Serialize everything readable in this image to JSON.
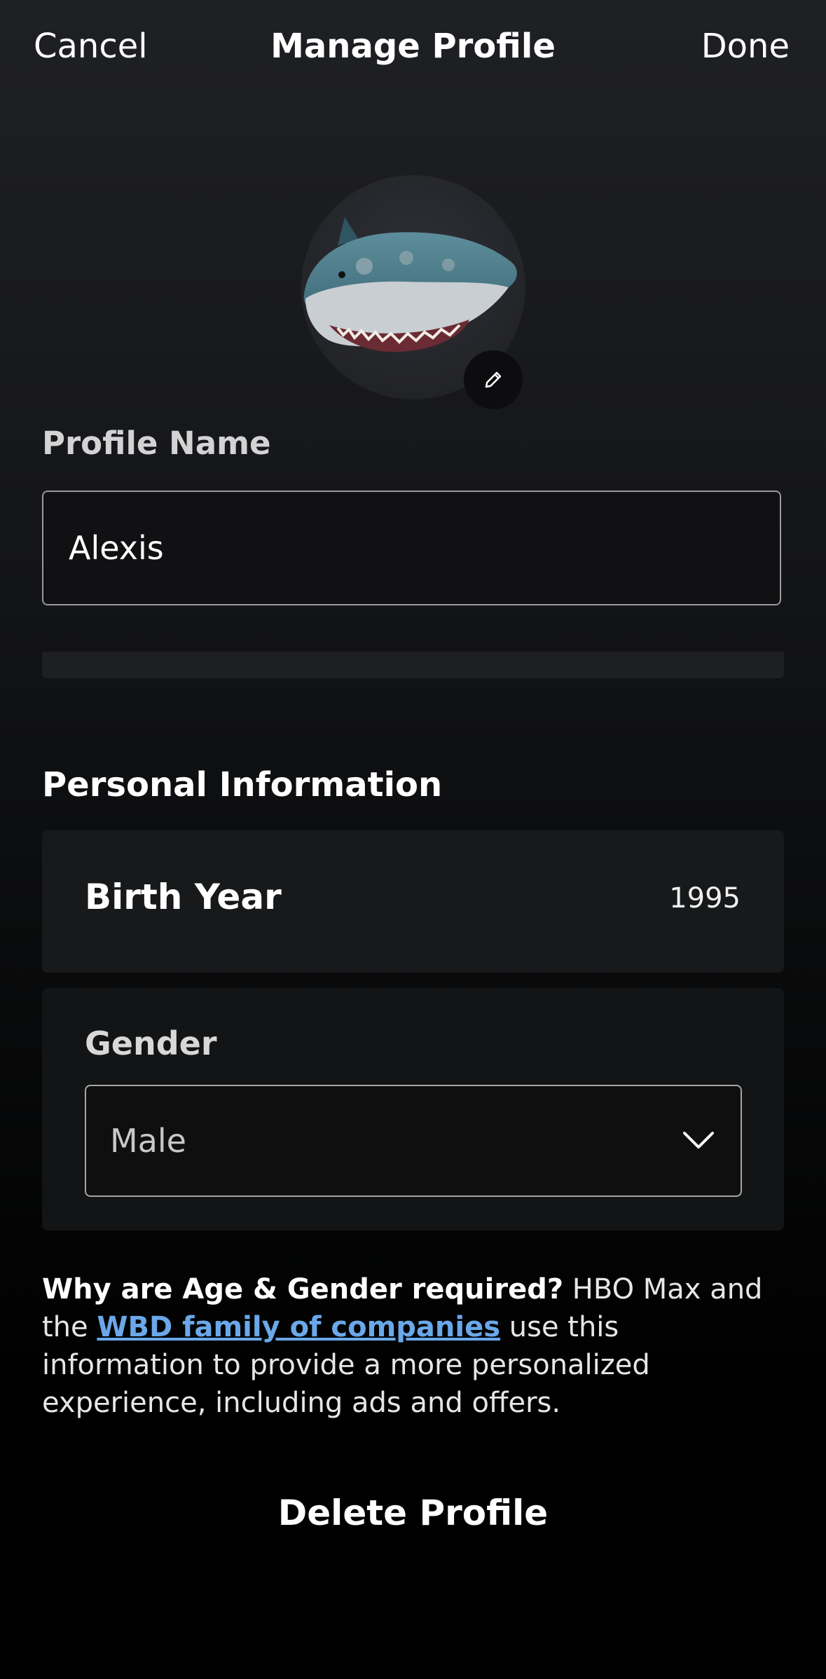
{
  "header": {
    "cancel_label": "Cancel",
    "title": "Manage Profile",
    "done_label": "Done"
  },
  "avatar": {
    "icon": "shark-avatar",
    "edit_icon": "pencil-icon"
  },
  "profile_name": {
    "label": "Profile Name",
    "value": "Alexis"
  },
  "personal_info": {
    "heading": "Personal Information",
    "birth_year": {
      "label": "Birth Year",
      "value": "1995"
    },
    "gender": {
      "label": "Gender",
      "selected": "Male",
      "icon": "chevron-down-icon"
    }
  },
  "info": {
    "question": "Why are Age & Gender required?",
    "text_before_link": " HBO Max and the ",
    "link_text": "WBD family of companies",
    "text_after_link": " use this information to provide a more personalized experience, including ads and offers."
  },
  "actions": {
    "delete_label": "Delete Profile"
  },
  "colors": {
    "link": "#6aa8ea",
    "card_background": "#17191b",
    "field_border": "#9a9a9a"
  }
}
